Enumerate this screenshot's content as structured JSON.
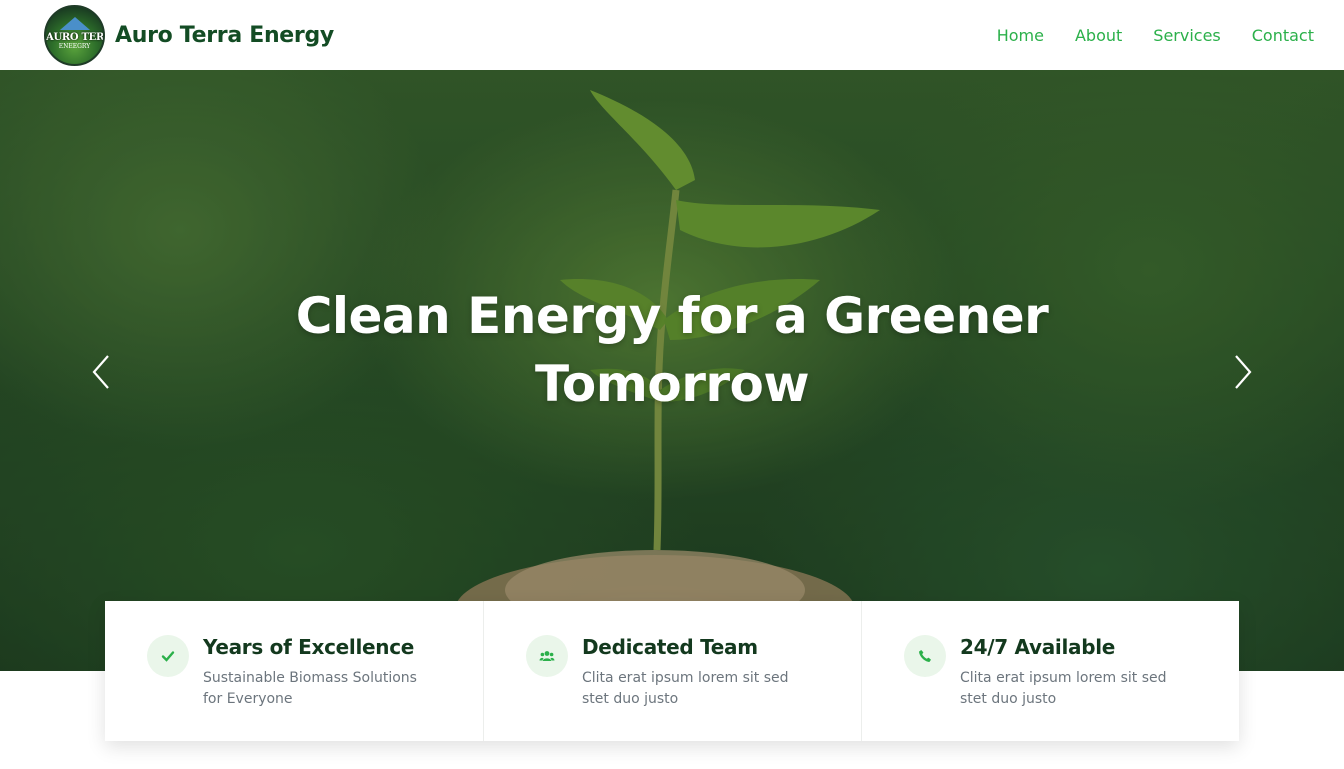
{
  "navbar": {
    "logo": {
      "text_line1": "AURO TERRA",
      "text_line2": "ENEEGRY"
    },
    "brand_name": "Auro Terra Energy",
    "links": [
      {
        "label": "Home"
      },
      {
        "label": "About"
      },
      {
        "label": "Services"
      },
      {
        "label": "Contact"
      }
    ]
  },
  "hero": {
    "title": "Clean Energy for a Greener Tomorrow",
    "prev_icon": "chevron-left-icon",
    "next_icon": "chevron-right-icon"
  },
  "features": [
    {
      "icon": "check-icon",
      "title": "Years of Excellence",
      "text": "Sustainable Biomass Solutions for Everyone"
    },
    {
      "icon": "users-icon",
      "title": "Dedicated Team",
      "text": "Clita erat ipsum lorem sit sed stet duo justo"
    },
    {
      "icon": "phone-icon",
      "title": "24/7 Available",
      "text": "Clita erat ipsum lorem sit sed stet duo justo"
    }
  ],
  "colors": {
    "accent": "#2bb04a",
    "brand_dark": "#134c24",
    "icon_bg": "#eaf6ea"
  }
}
